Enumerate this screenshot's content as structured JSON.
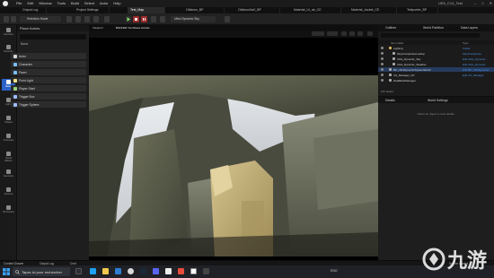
{
  "menubar": {
    "menus": [
      "File",
      "Edit",
      "Window",
      "Tools",
      "Build",
      "Select",
      "Actor",
      "Help"
    ],
    "project": "UE5_C14_Test"
  },
  "tabs": [
    {
      "label": "Output Log"
    },
    {
      "label": "Project Settings"
    },
    {
      "label": "Test_Map",
      "active": true
    },
    {
      "label": "Oldtown_BP"
    },
    {
      "label": "Oldtown0w0_BP"
    },
    {
      "label": "Material_UI_ab_CE"
    },
    {
      "label": "Material_Jacket_CE"
    },
    {
      "label": "Teleporter_BP"
    }
  ],
  "toolbar": {
    "mode": "Selection Mode",
    "platform": "Ultra Dynamic Sky"
  },
  "rail": [
    {
      "label": "Favorites",
      "icon": "star-icon"
    },
    {
      "label": "Recently",
      "icon": "clock-icon"
    },
    {
      "label": "Basic",
      "icon": "cube-icon",
      "active": true
    },
    {
      "label": "Lights",
      "icon": "bulb-icon"
    },
    {
      "label": "Shapes",
      "icon": "shapes-icon"
    },
    {
      "label": "Cinematic",
      "icon": "camera-icon"
    },
    {
      "label": "Visual Effects",
      "icon": "sparkle-icon"
    },
    {
      "label": "Geometry",
      "icon": "geometry-icon"
    },
    {
      "label": "Volumes",
      "icon": "volume-icon"
    },
    {
      "label": "All Classes",
      "icon": "classes-icon"
    }
  ],
  "place_actors": {
    "title": "Place Actors",
    "basic_header": "Basic",
    "items": [
      {
        "label": "Actor",
        "color": "#d9d9d9"
      },
      {
        "label": "Character",
        "color": "#7cbfff"
      },
      {
        "label": "Pawn",
        "color": "#7cbfff"
      },
      {
        "label": "Point Light",
        "color": "#f0e08a"
      },
      {
        "label": "Player Start",
        "color": "#9bd37a"
      },
      {
        "label": "Trigger Box",
        "color": "#9ec0ff"
      },
      {
        "label": "Trigger Sphere",
        "color": "#9ec0ff"
      }
    ]
  },
  "viewport": {
    "tab_label": "Viewport",
    "sub_label": "BUFFER: No Mouse Access"
  },
  "outliner": {
    "tab_outliner": "Outliner",
    "tab_world": "World Partition",
    "tab_layers": "Data Layers",
    "col_label": "Item Label",
    "col_type": "Type",
    "rows": [
      {
        "name": "Lighting",
        "type": "Folder",
        "indent": 1,
        "folder": true
      },
      {
        "name": "SkyAtmosphereLookup",
        "type": "SkyAtmosphere",
        "indent": 2
      },
      {
        "name": "Ultra_Dynamic_Sky",
        "type": "Edit Ultra_Dynamic",
        "indent": 2
      },
      {
        "name": "Ultra_Dynamic_Weather",
        "type": "Edit Ultra_Dynamic",
        "indent": 2
      },
      {
        "name": "BP_UltraDynamicSystemWorld",
        "type": "Edit BP_UltraDynamic",
        "indent": 1,
        "selected": true
      },
      {
        "name": "CS_Manager_CP",
        "type": "Edit CS_Manager",
        "indent": 1
      },
      {
        "name": "DataBankManager",
        "type": "",
        "indent": 1
      }
    ],
    "footer": "197 actors"
  },
  "details": {
    "tab_details": "Details",
    "tab_world": "World Settings",
    "empty_text": "Select an object to view details."
  },
  "status": {
    "content_drawer": "Content Drawer",
    "output_log": "Output Log",
    "cmd": "Cmd",
    "right": "Source Control"
  },
  "taskbar": {
    "search_placeholder": "Tapez ici pour rechercher",
    "tray_text": "ENG"
  },
  "watermark": "九游"
}
